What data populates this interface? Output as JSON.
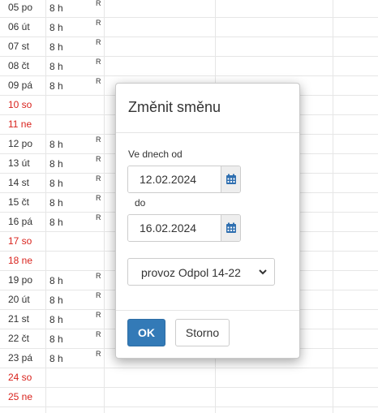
{
  "calendar": {
    "rows": [
      {
        "day": "05 po",
        "weekend": false,
        "hours": "8 h",
        "mark": "R"
      },
      {
        "day": "06 út",
        "weekend": false,
        "hours": "8 h",
        "mark": "R"
      },
      {
        "day": "07 st",
        "weekend": false,
        "hours": "8 h",
        "mark": "R"
      },
      {
        "day": "08 čt",
        "weekend": false,
        "hours": "8 h",
        "mark": "R"
      },
      {
        "day": "09 pá",
        "weekend": false,
        "hours": "8 h",
        "mark": "R"
      },
      {
        "day": "10 so",
        "weekend": true,
        "hours": "",
        "mark": ""
      },
      {
        "day": "11 ne",
        "weekend": true,
        "hours": "",
        "mark": ""
      },
      {
        "day": "12 po",
        "weekend": false,
        "hours": "8 h",
        "mark": "R"
      },
      {
        "day": "13 út",
        "weekend": false,
        "hours": "8 h",
        "mark": "R"
      },
      {
        "day": "14 st",
        "weekend": false,
        "hours": "8 h",
        "mark": "R"
      },
      {
        "day": "15 čt",
        "weekend": false,
        "hours": "8 h",
        "mark": "R"
      },
      {
        "day": "16 pá",
        "weekend": false,
        "hours": "8 h",
        "mark": "R"
      },
      {
        "day": "17 so",
        "weekend": true,
        "hours": "",
        "mark": ""
      },
      {
        "day": "18 ne",
        "weekend": true,
        "hours": "",
        "mark": ""
      },
      {
        "day": "19 po",
        "weekend": false,
        "hours": "8 h",
        "mark": "R"
      },
      {
        "day": "20 út",
        "weekend": false,
        "hours": "8 h",
        "mark": "R"
      },
      {
        "day": "21 st",
        "weekend": false,
        "hours": "8 h",
        "mark": "R"
      },
      {
        "day": "22 čt",
        "weekend": false,
        "hours": "8 h",
        "mark": "R"
      },
      {
        "day": "23 pá",
        "weekend": false,
        "hours": "8 h",
        "mark": "R"
      },
      {
        "day": "24 so",
        "weekend": true,
        "hours": "",
        "mark": ""
      },
      {
        "day": "25 ne",
        "weekend": true,
        "hours": "",
        "mark": ""
      }
    ],
    "weekend_color": "#d9231d"
  },
  "modal": {
    "title": "Změnit směnu",
    "from_label": "Ve dnech od",
    "from_date": "12.02.2024",
    "to_label": "do",
    "to_date": "16.02.2024",
    "calendar_icon": "calendar-icon",
    "shift_selected": "provoz Odpol 14-22",
    "ok_label": "OK",
    "cancel_label": "Storno",
    "primary_color": "#337ab7"
  }
}
